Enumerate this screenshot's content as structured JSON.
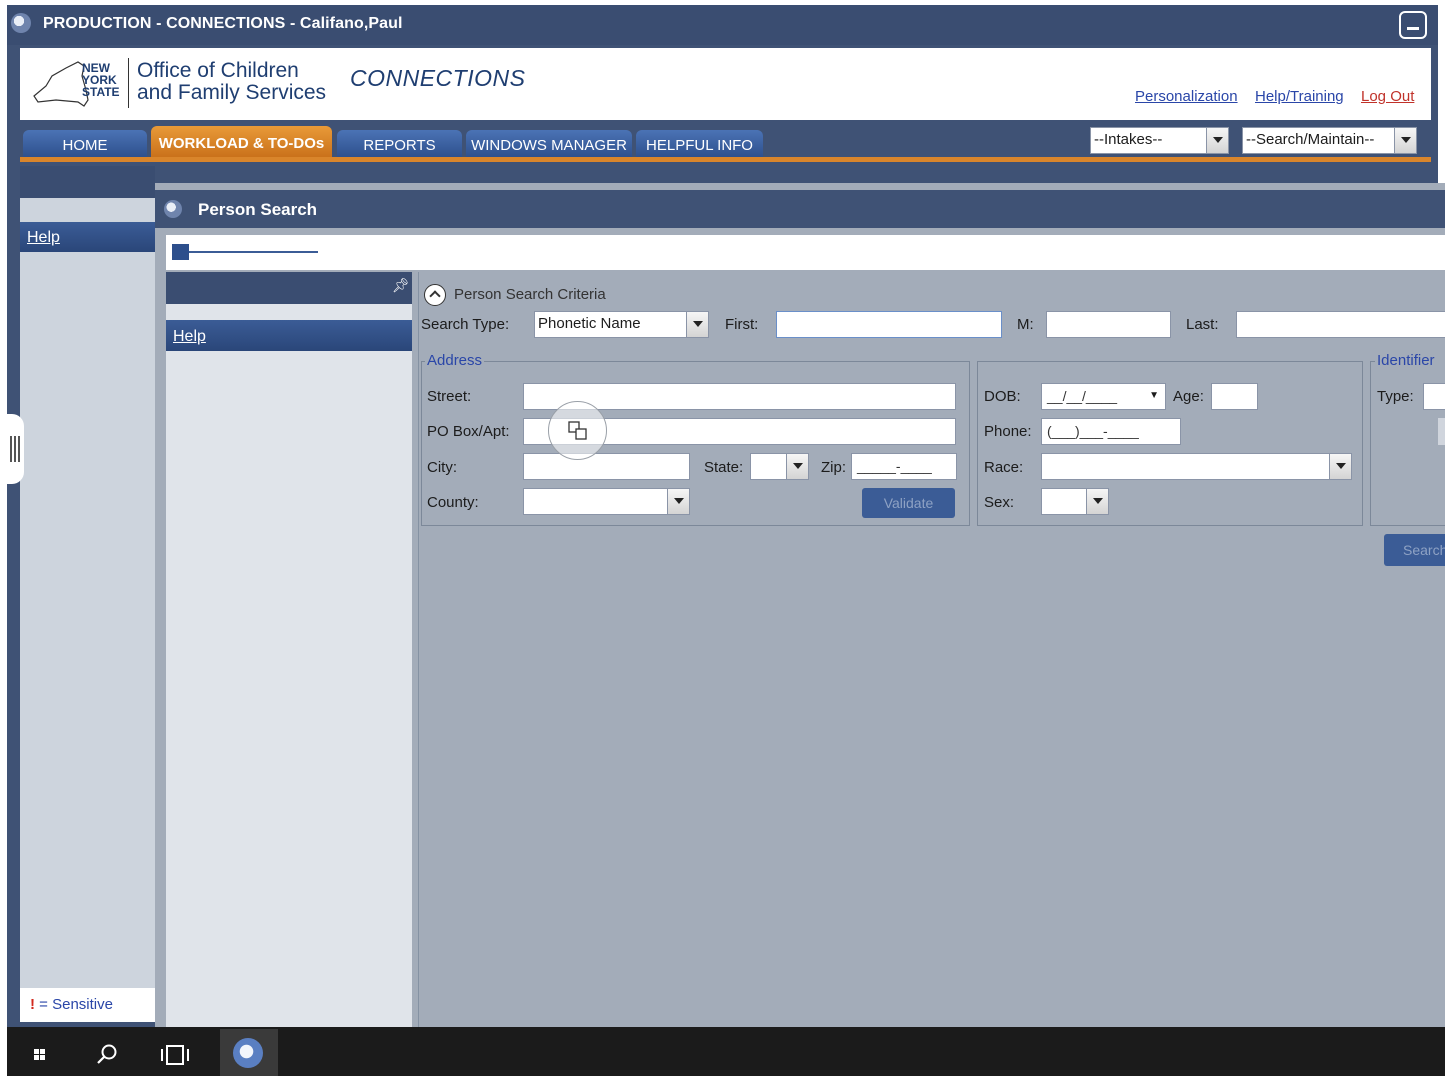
{
  "app": {
    "window_title": "PRODUCTION - CONNECTIONS - Califano,Paul"
  },
  "header": {
    "logo_line1": "NEW",
    "logo_line2": "YORK",
    "logo_line3": "STATE",
    "org_line1": "Office of Children",
    "org_line2": "and Family Services",
    "product": "CONNECTIONS",
    "links": {
      "personalization": "Personalization",
      "help_training": "Help/Training",
      "log_out": "Log Out"
    }
  },
  "nav": {
    "tabs": [
      "HOME",
      "WORKLOAD & TO-DOs",
      "REPORTS",
      "WINDOWS MANAGER",
      "HELPFUL INFO"
    ],
    "active_tab": "WORKLOAD & TO-DOs",
    "intakes_select": "--Intakes--",
    "search_select": "--Search/Maintain--"
  },
  "outer_sidebar": {
    "help": "Help",
    "legend_bang": "!",
    "legend_text": " = Sensitive"
  },
  "person_search": {
    "title": "Person Search",
    "sidebar_help": "Help",
    "section_title": "Person Search Criteria",
    "search_type_label": "Search Type:",
    "search_type_value": "Phonetic Name",
    "first_label": "First:",
    "first_value": "",
    "middle_label": "M:",
    "last_label": "Last:",
    "address": {
      "legend": "Address",
      "street_label": "Street:",
      "po_box_label": "PO Box/Apt:",
      "city_label": "City:",
      "state_label": "State:",
      "zip_label": "Zip:",
      "zip_mask": "_____-____",
      "county_label": "County:",
      "validate_button": "Validate"
    },
    "demographics": {
      "dob_label": "DOB:",
      "dob_mask": "__/__/____",
      "age_label": "Age:",
      "phone_label": "Phone:",
      "phone_mask": "(___)___-____",
      "race_label": "Race:",
      "sex_label": "Sex:"
    },
    "identifiers": {
      "legend": "Identifier",
      "type_label": "Type:"
    },
    "search_button": "Search"
  },
  "colors": {
    "frame": "#3f5275",
    "active_tab": "#e99a38",
    "tab": "#2d4f8c",
    "link": "#2a46a8",
    "logout_link": "#c0322a",
    "sensitive_bang": "#d22a1e",
    "panel_bg": "#a3acb9"
  },
  "taskbar": {
    "icons": [
      "windows-start-icon",
      "search-icon",
      "task-view-icon",
      "connections-app-icon"
    ]
  }
}
